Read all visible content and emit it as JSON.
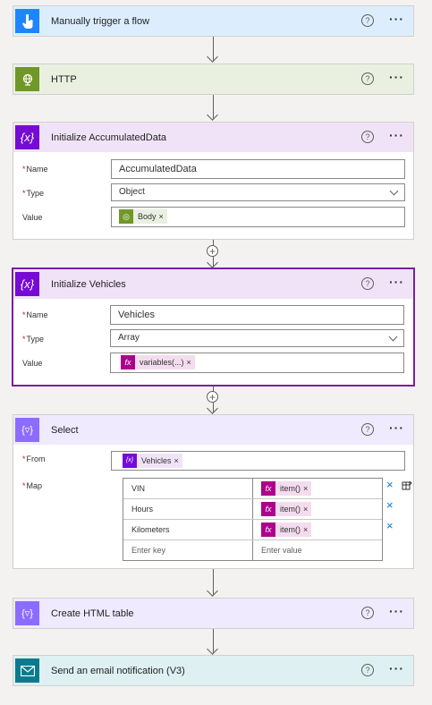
{
  "cards": {
    "trigger": {
      "title": "Manually trigger a flow",
      "color": "#1f85ff",
      "bg": "#dceefe"
    },
    "http": {
      "title": "HTTP",
      "color": "#709727",
      "bg": "#e9f0e0"
    },
    "init_accum": {
      "title": "Initialize AccumulatedData",
      "color": "#770bd6",
      "bg": "#f0e3f8",
      "name_label": "Name",
      "name_value": "AccumulatedData",
      "type_label": "Type",
      "type_value": "Object",
      "value_label": "Value",
      "value_token": "Body"
    },
    "init_vehicles": {
      "title": "Initialize Vehicles",
      "color": "#770bd6",
      "bg": "#f0e3f8",
      "name_label": "Name",
      "name_value": "Vehicles",
      "type_label": "Type",
      "type_value": "Array",
      "value_label": "Value",
      "value_token": "variables(...)"
    },
    "select": {
      "title": "Select",
      "color": "#8c6cff",
      "bg": "#efeafe",
      "from_label": "From",
      "from_token": "Vehicles",
      "map_label": "Map",
      "map_rows": [
        {
          "key": "VIN",
          "value": "item()"
        },
        {
          "key": "Hours",
          "value": "item()"
        },
        {
          "key": "Kilometers",
          "value": "item()"
        }
      ],
      "key_placeholder": "Enter key",
      "value_placeholder": "Enter value"
    },
    "html_table": {
      "title": "Create HTML table",
      "color": "#8c6cff",
      "bg": "#efeafe"
    },
    "email": {
      "title": "Send an email notification (V3)",
      "color": "#0a7a8c",
      "bg": "#def0f2"
    }
  },
  "common": {
    "help": "?",
    "more": "···",
    "required": "*",
    "close": "×",
    "plus": "+"
  },
  "icons": {
    "trigger": "hand-tap-icon",
    "http": "globe-icon",
    "variable": "variable-icon",
    "data_operation": "data-operation-icon",
    "email": "envelope-icon",
    "expression": "function-icon"
  }
}
